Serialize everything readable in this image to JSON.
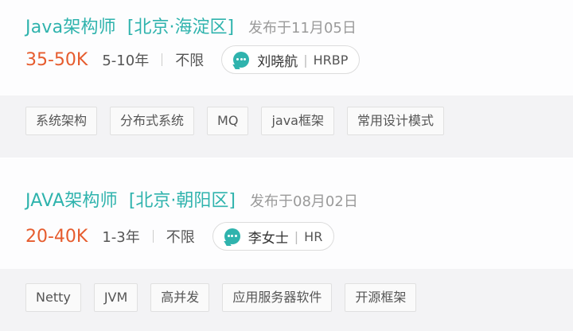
{
  "jobs": [
    {
      "title": "Java架构师",
      "location": "[北京·海淀区]",
      "publish_time": "发布于11月05日",
      "salary": "35-50K",
      "experience": "5-10年",
      "education": "不限",
      "recruiter": {
        "name": "刘晓航",
        "separator": "|",
        "role": "HRBP"
      },
      "tags": [
        "系统架构",
        "分布式系统",
        "MQ",
        "java框架",
        "常用设计模式"
      ]
    },
    {
      "title": "JAVA架构师",
      "location": "[北京·朝阳区]",
      "publish_time": "发布于08月02日",
      "salary": "20-40K",
      "experience": "1-3年",
      "education": "不限",
      "recruiter": {
        "name": "李女士",
        "separator": "|",
        "role": "HR"
      },
      "tags": [
        "Netty",
        "JVM",
        "高并发",
        "应用服务器软件",
        "开源框架"
      ]
    }
  ],
  "colors": {
    "accent": "#2fb3ad",
    "salary": "#e65c2e",
    "muted": "#9a9a9a",
    "tag_bar": "#f3f3f5"
  },
  "icons": {
    "chat": "chat-bubble-icon"
  }
}
